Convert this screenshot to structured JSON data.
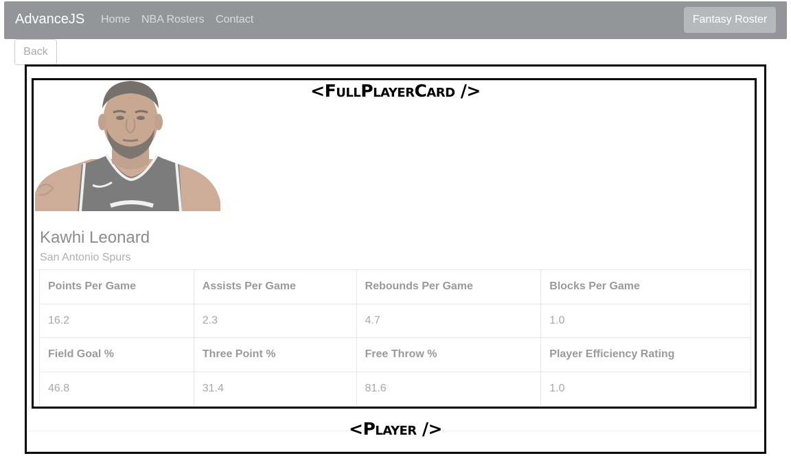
{
  "navbar": {
    "brand": "AdvanceJS",
    "links": [
      "Home",
      "NBA Rosters",
      "Contact"
    ],
    "fantasy_button": "Fantasy Roster"
  },
  "back_button": "Back",
  "labels": {
    "full_player_card": "<FullPlayerCard />",
    "player": "<Player />"
  },
  "player": {
    "name": "Kawhi Leonard",
    "team": "San Antonio Spurs"
  },
  "stats": {
    "row1_headers": [
      "Points Per Game",
      "Assists Per Game",
      "Rebounds Per Game",
      "Blocks Per Game"
    ],
    "row1_values": [
      "16.2",
      "2.3",
      "4.7",
      "1.0"
    ],
    "row2_headers": [
      "Field Goal %",
      "Three Point %",
      "Free Throw %",
      "Player Efficiency Rating"
    ],
    "row2_values": [
      "46.8",
      "31.4",
      "81.6",
      "1.0"
    ]
  },
  "colors": {
    "navbar_bg": "#939598",
    "fantasy_button_bg": "#b7b8ba",
    "border": "#000000"
  },
  "icons": {
    "player_photo": "player-photo"
  }
}
